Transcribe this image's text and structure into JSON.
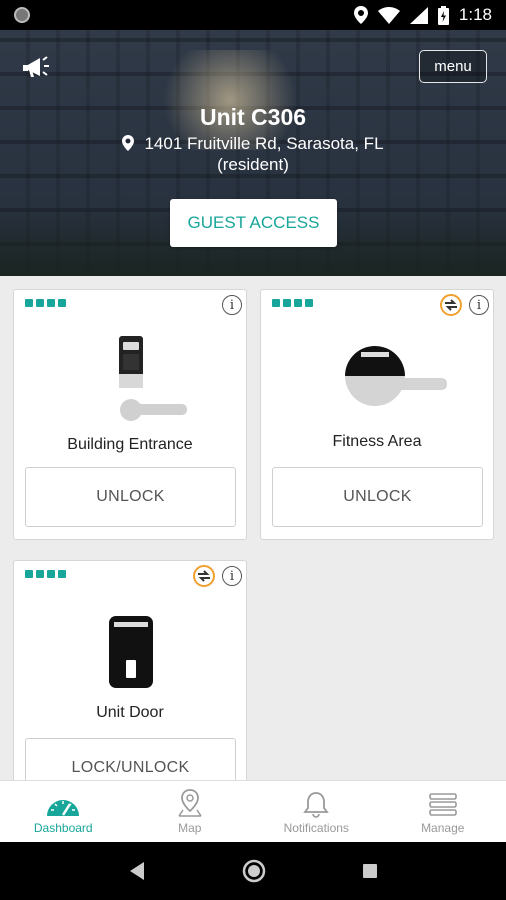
{
  "status_bar": {
    "time": "1:18"
  },
  "header": {
    "menu_label": "menu",
    "unit_title": "Unit C306",
    "address_line": "1401 Fruitville Rd, Sarasota, FL",
    "role": "(resident)",
    "guest_access_label": "GUEST ACCESS"
  },
  "locks": [
    {
      "name": "Building Entrance",
      "action": "UNLOCK"
    },
    {
      "name": "Fitness Area",
      "action": "UNLOCK"
    },
    {
      "name": "Unit Door",
      "action": "LOCK/UNLOCK"
    }
  ],
  "bottom_nav": [
    {
      "label": "Dashboard",
      "icon": "speedometer-icon",
      "active": true
    },
    {
      "label": "Map",
      "icon": "map-pin-icon"
    },
    {
      "label": "Notifications",
      "icon": "bell-icon"
    },
    {
      "label": "Manage",
      "icon": "stack-icon"
    }
  ],
  "colors": {
    "accent": "#19a69a",
    "sync_ring": "#f0a030"
  }
}
